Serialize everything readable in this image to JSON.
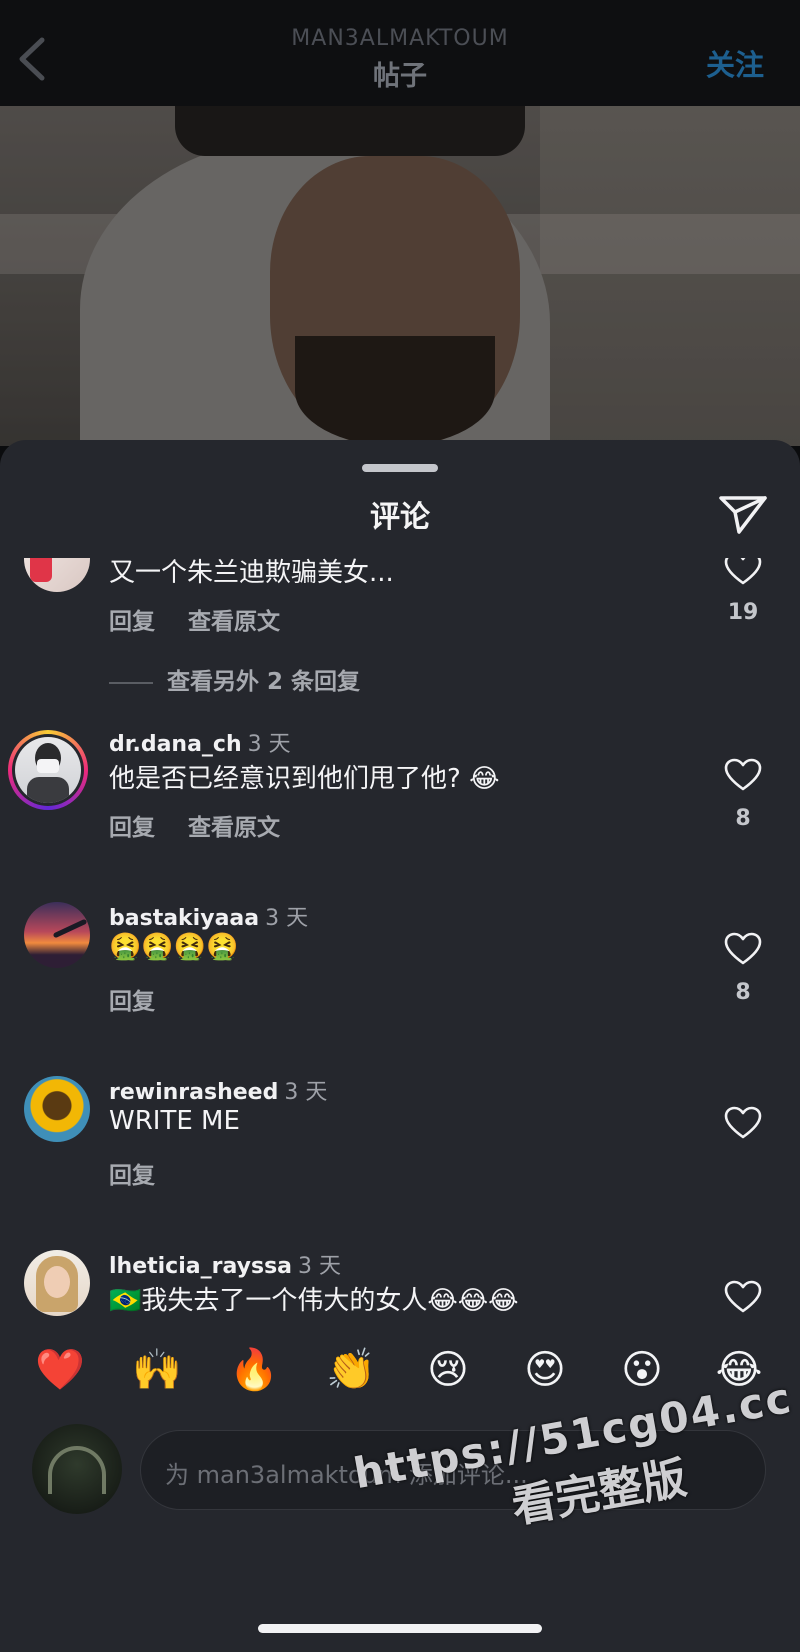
{
  "header": {
    "username": "MAN3ALMAKTOUM",
    "title": "帖子",
    "follow_label": "关注"
  },
  "sheet": {
    "title": "评论"
  },
  "comments": [
    {
      "username": "",
      "time": "",
      "text": "又一个朱兰迪欺骗美女...",
      "reply_label": "回复",
      "translate_label": "查看原文",
      "likes": "19",
      "more_replies": "查看另外 2 条回复"
    },
    {
      "username": "dr.dana_ch",
      "time": "3 天",
      "text": "他是否已经意识到他们甩了他? 😂",
      "reply_label": "回复",
      "translate_label": "查看原文",
      "likes": "8"
    },
    {
      "username": "bastakiyaaa",
      "time": "3 天",
      "text": "🤮🤮🤮🤮",
      "reply_label": "回复",
      "likes": "8"
    },
    {
      "username": "rewinrasheed",
      "time": "3 天",
      "text": "WRITE ME",
      "reply_label": "回复",
      "likes": ""
    },
    {
      "username": "lheticia_rayssa",
      "time": "3 天",
      "text": "🇧🇷我失去了一个伟大的女人😂😂😂",
      "likes": ""
    }
  ],
  "emoji_reactions": [
    "❤️",
    "🙌",
    "🔥",
    "👏",
    "😢",
    "😍",
    "😮",
    "😂"
  ],
  "composer": {
    "placeholder": "为 man3almaktoum 添加评论..."
  },
  "watermark": {
    "line1": "https://51cg04.cc",
    "line2": "看完整版"
  },
  "colors": {
    "sheet_bg": "#25272d",
    "follow_blue": "#1d5f8f",
    "accent_ring": "#d62976"
  }
}
